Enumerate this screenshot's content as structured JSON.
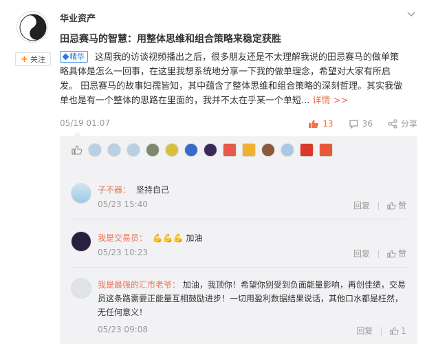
{
  "post": {
    "author": "华业资产",
    "follow_label": "关注",
    "title": "田忌赛马的智慧：用整体思维和组合策略来稳定获胜",
    "badge": "精华",
    "body": "这周我的访谈视频播出之后，很多朋友还是不太理解我说的田忌赛马的做单策略具体是怎么一回事，在这里我想系统地分享一下我的做单理念，希望对大家有所启发。 田忌赛马的故事妇孺皆知，其中蕴含了整体思维和组合策略的深刻哲理。其实我做单也是有一个整体的思路在里面的，我并不太在乎某一个单短...",
    "more": "详情 >>",
    "time": "05/19 01:07",
    "likes": "13",
    "comments_count": "36",
    "share_label": "分享"
  },
  "colors": {
    "accent": "#eb7350",
    "badge_blue": "#2f7ad6",
    "panel_bg": "#f2f2f5"
  },
  "comments": [
    {
      "name": "子不器",
      "sep": "：",
      "text": "坚持自己",
      "time": "05/23 15:40",
      "reply": "回复",
      "zan": "赞"
    },
    {
      "name": "我是交易员",
      "sep": "：",
      "text": "加油",
      "emoji": [
        "muscle-emoji",
        "muscle-emoji",
        "muscle-emoji"
      ],
      "time": "05/23 10:23",
      "reply": "回复",
      "zan": "赞"
    },
    {
      "name": "我是最强的汇市老爷",
      "sep": "：",
      "text": "加油，我顶你！希望你别受到负面能量影响，再创佳绩，交易员这条路需要正能量互相鼓励进步！一切用盈利数据结果说话，其他口水都是枉然，无任何意义！",
      "time": "05/23 09:08",
      "reply": "回复",
      "zan": "1"
    }
  ]
}
